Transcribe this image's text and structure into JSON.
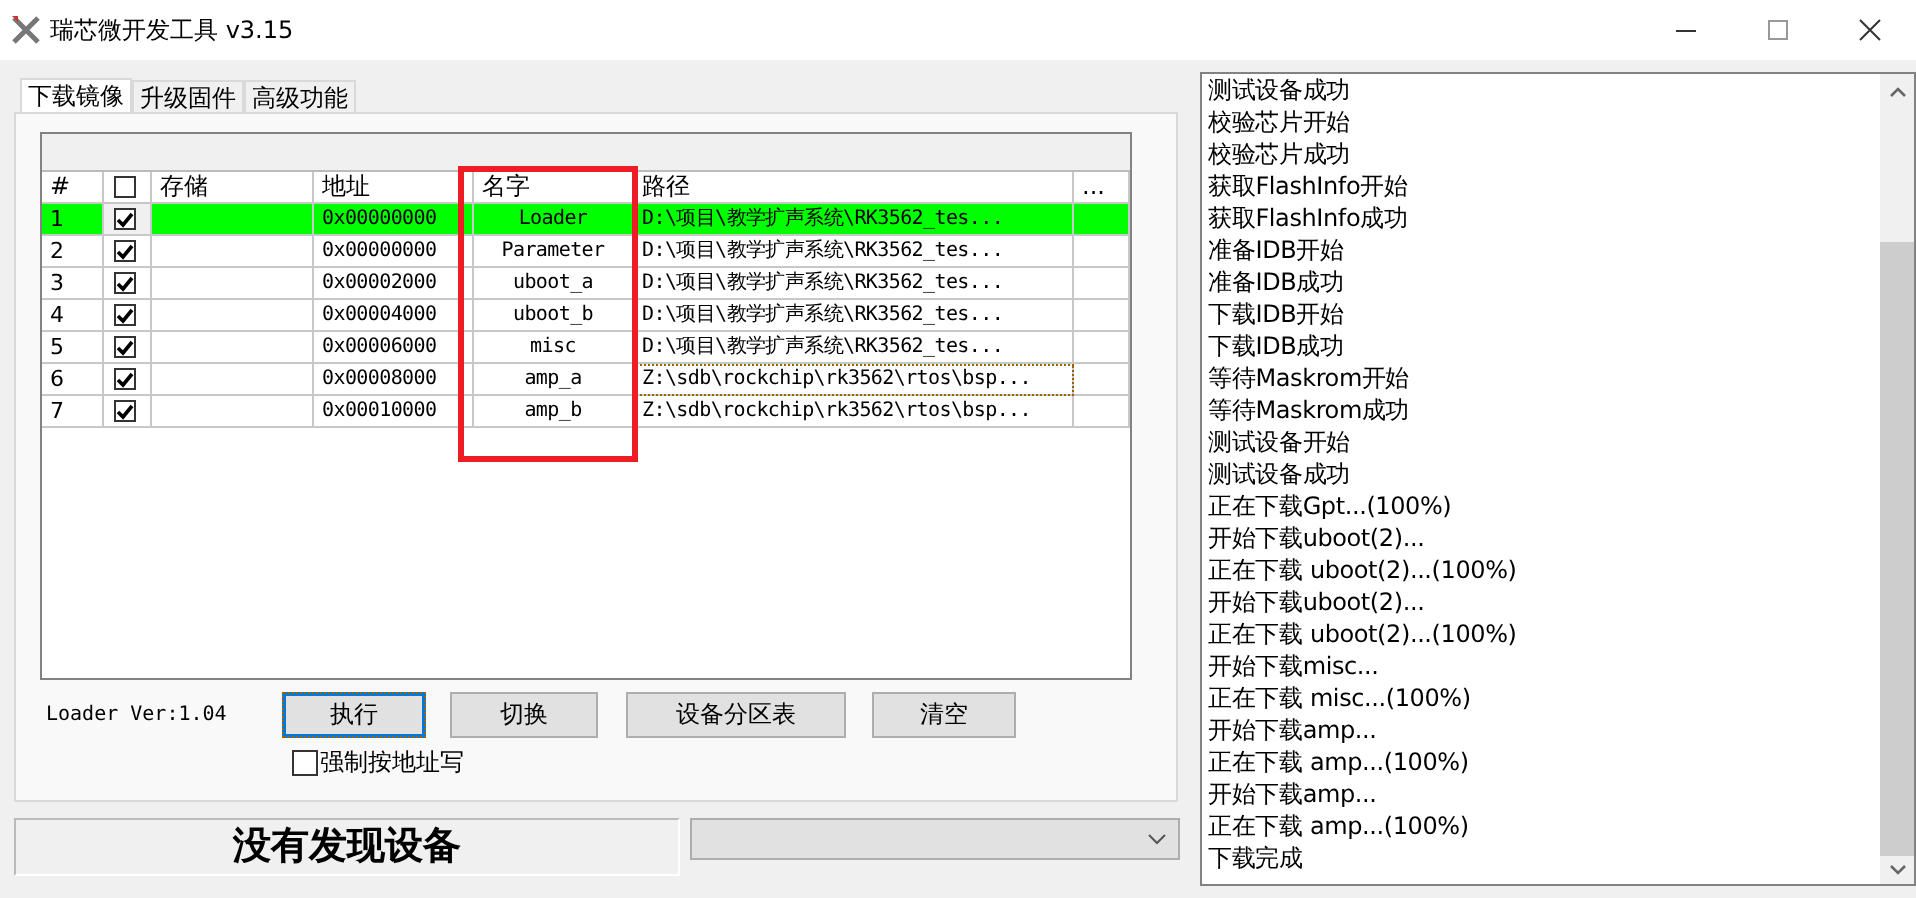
{
  "window": {
    "title": "瑞芯微开发工具 v3.15"
  },
  "tabs": [
    {
      "label": "下载镜像",
      "selected": true
    },
    {
      "label": "升级固件",
      "selected": false
    },
    {
      "label": "高级功能",
      "selected": false
    }
  ],
  "table": {
    "columns": [
      "#",
      "存储",
      "地址",
      "名字",
      "路径",
      "..."
    ],
    "select_all_checked": false,
    "rows": [
      {
        "num": "1",
        "checked": true,
        "address": "0x00000000",
        "name": "Loader",
        "path": "D:\\项目\\教学扩声系统\\RK3562_tes...",
        "selected": true,
        "focused": false
      },
      {
        "num": "2",
        "checked": true,
        "address": "0x00000000",
        "name": "Parameter",
        "path": "D:\\项目\\教学扩声系统\\RK3562_tes...",
        "selected": false,
        "focused": false
      },
      {
        "num": "3",
        "checked": true,
        "address": "0x00002000",
        "name": "uboot_a",
        "path": "D:\\项目\\教学扩声系统\\RK3562_tes...",
        "selected": false,
        "focused": false
      },
      {
        "num": "4",
        "checked": true,
        "address": "0x00004000",
        "name": "uboot_b",
        "path": "D:\\项目\\教学扩声系统\\RK3562_tes...",
        "selected": false,
        "focused": false
      },
      {
        "num": "5",
        "checked": true,
        "address": "0x00006000",
        "name": "misc",
        "path": "D:\\项目\\教学扩声系统\\RK3562_tes...",
        "selected": false,
        "focused": false
      },
      {
        "num": "6",
        "checked": true,
        "address": "0x00008000",
        "name": "amp_a",
        "path": "Z:\\sdb\\rockchip\\rk3562\\rtos\\bsp...",
        "selected": false,
        "focused": true
      },
      {
        "num": "7",
        "checked": true,
        "address": "0x00010000",
        "name": "amp_b",
        "path": "Z:\\sdb\\rockchip\\rk3562\\rtos\\bsp...",
        "selected": false,
        "focused": false
      }
    ]
  },
  "loader_version": "Loader Ver:1.04",
  "buttons": [
    {
      "label": "执行",
      "focused": true
    },
    {
      "label": "切换",
      "focused": false
    },
    {
      "label": "设备分区表",
      "focused": false
    },
    {
      "label": "清空",
      "focused": false
    }
  ],
  "force_address_write": {
    "label": "强制按地址写",
    "checked": false
  },
  "status": "没有发现设备",
  "log": [
    "测试设备成功",
    "校验芯片开始",
    "校验芯片成功",
    "获取FlashInfo开始",
    "获取FlashInfo成功",
    "准备IDB开始",
    "准备IDB成功",
    "下载IDB开始",
    "下载IDB成功",
    "等待Maskrom开始",
    "等待Maskrom成功",
    "测试设备开始",
    "测试设备成功",
    "正在下载Gpt...(100%)",
    "开始下载uboot(2)...",
    "正在下载 uboot(2)...(100%)",
    "开始下载uboot(2)...",
    "正在下载 uboot(2)...(100%)",
    "开始下载misc...",
    "正在下载 misc...(100%)",
    "开始下载amp...",
    "正在下载 amp...(100%)",
    "开始下载amp...",
    "正在下载 amp...(100%)",
    "下载完成"
  ]
}
